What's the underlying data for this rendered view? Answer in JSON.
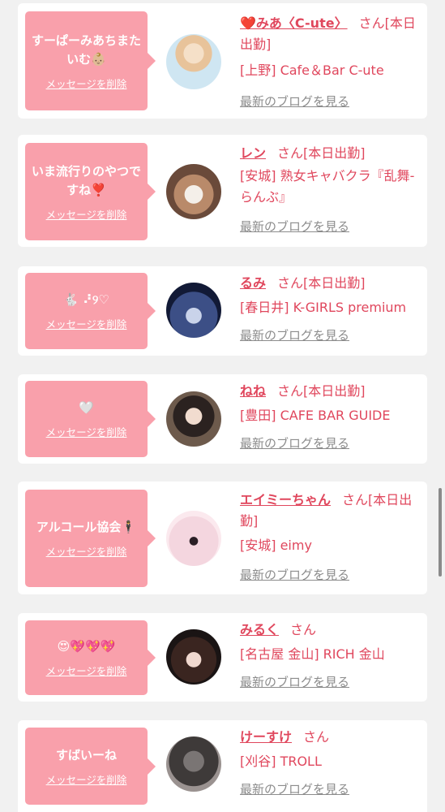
{
  "entries": [
    {
      "message": "すーぱーみあちまたいむ👶🏼",
      "delete_label": "メッセージを削除",
      "name": "❤️みあ〈C-ute〉",
      "san": "さん",
      "status": "[本日出勤]",
      "shop": "[上野] Cafe＆Bar C-ute",
      "blog_label": "最新のブログを見る"
    },
    {
      "message": "いま流行りのやつですね❣️",
      "delete_label": "メッセージを削除",
      "name": "レン",
      "san": "さん",
      "status": "[本日出勤]",
      "shop": "[安城] 熟女キャバクラ『乱舞-らんぶ』",
      "blog_label": "最新のブログを見る"
    },
    {
      "message": "🐇 ⠜୨♡",
      "delete_label": "メッセージを削除",
      "name": "るみ",
      "san": "さん",
      "status": "[本日出勤]",
      "shop": "[春日井] K-GIRLS premium",
      "blog_label": "最新のブログを見る"
    },
    {
      "message": "🤍",
      "delete_label": "メッセージを削除",
      "name": "ねね",
      "san": "さん",
      "status": "[本日出勤]",
      "shop": "[豊田] CAFE BAR GUIDE",
      "blog_label": "最新のブログを見る"
    },
    {
      "message": "アルコール協会🕴",
      "delete_label": "メッセージを削除",
      "name": "エイミーちゃん",
      "san": "さん",
      "status": "[本日出勤]",
      "shop": "[安城] eimy",
      "blog_label": "最新のブログを見る"
    },
    {
      "message": "😍💖💖💖",
      "delete_label": "メッセージを削除",
      "name": "みるく",
      "san": "さん",
      "status": "",
      "shop": "[名古屋 金山] RICH 金山",
      "blog_label": "最新のブログを見る"
    },
    {
      "message": "すばいーね",
      "delete_label": "メッセージを削除",
      "name": "けーすけ",
      "san": "さん",
      "status": "",
      "shop": "[刈谷] TROLL",
      "blog_label": "最新のブログを見る"
    }
  ],
  "colors": {
    "bubble": "#f9a0ab",
    "name": "#e0475d",
    "blog_link": "#8c8c8c",
    "background": "#f1f1f1"
  }
}
